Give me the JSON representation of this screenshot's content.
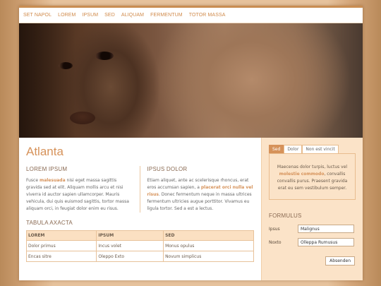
{
  "nav": [
    "SET NAPOL",
    "LOREM",
    "IPSUM",
    "SED",
    "ALIQUAM",
    "FERMENTUM",
    "TOTOR MASSA"
  ],
  "page_title": "Atlanta",
  "col1": {
    "heading": "LOREM IPSUM",
    "pre": "Fusce ",
    "highlight": "malesuada",
    "post": " nisi eget massa sagittis gravida sed at elit. Aliquam mollis arcu et nisi viverra id auctor sapien ullamcorper. Mauris vehicula, dui quis euismod sagittis, tortor massa aliquam orci, in feugiat dolor enim eu risus."
  },
  "col2": {
    "heading": "IPSUS DOLOR",
    "pre": "Etiam aliquet, ante ac scelerisque rhoncus, erat eros accumsan sapien, a ",
    "highlight": "placerat orci nulla vel risus",
    "post": ". Donec fermentum neque in massa ultrices fermentum ultricies augue porttitor. Vivamus eu ligula tortor. Sed a est a lectus."
  },
  "table": {
    "title": "TABULA AXACTA",
    "headers": [
      "LOREM",
      "IPSUM",
      "SED"
    ],
    "rows": [
      [
        "Dolor primus",
        "Incus volet",
        "Monus opulus"
      ],
      [
        "Encas sitre",
        "Oleppo Exto",
        "Novum simplicus"
      ]
    ]
  },
  "tabs": [
    "Sed",
    "Dolor",
    "Non est vincit"
  ],
  "tab_content": {
    "pre": "Maecenas dolor turpis, luctus vel ",
    "highlight": "molestie commodo",
    "post": ", convallis convallis purus. Praesent gravida erat eu sem vestibulum semper."
  },
  "form": {
    "title": "FORMULUS",
    "fields": [
      {
        "label": "Ipsus",
        "value": "Malignus"
      },
      {
        "label": "Noxto",
        "value": "Olleppa Rumusus"
      }
    ],
    "submit": "Absenden"
  },
  "colors": {
    "accent": "#d6925a",
    "nav_text": "#d08a4a",
    "sidebar_bg": "#fbe3c8",
    "topbar": "#c98d52"
  }
}
